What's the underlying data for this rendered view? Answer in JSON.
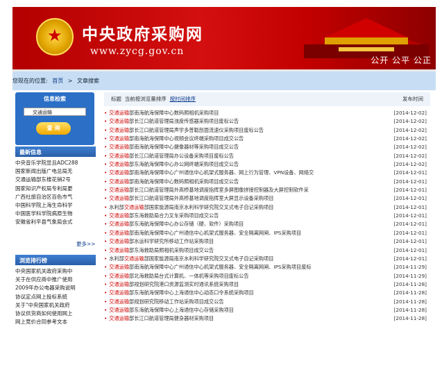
{
  "banner": {
    "title": "中央政府采购网",
    "url": "www.zycg.gov.cn",
    "slogan": "公开 公平 公正"
  },
  "breadcrumb": {
    "prefix": "您现在的位置:",
    "home": "首页",
    "sep": ">",
    "current": "文章搜索"
  },
  "search": {
    "title": "信息检索",
    "value": "交通运输",
    "button": "查 询"
  },
  "latest": {
    "title": "最新信息",
    "items": [
      "中央音乐学院显且ADC288",
      "国家新闻出版广电总局无",
      "交通运输部东楼花销2号",
      "国家知识产权局专利局更",
      "广西社旅自治区百色市气",
      "中国科学院上海生命科学",
      "中国医学科学院病原生物",
      "安徽省利辛县气象局会式"
    ],
    "more": "更多>>"
  },
  "ranking": {
    "title": "浏览排行榜",
    "items": [
      "中央国家机关政府采购中",
      "关于在供应商中推广使用",
      "2009年办公电器采购说明",
      "协议定点网上投标系统",
      "关于\"中央国家机关政府",
      "协议供货商如何使用网上",
      "网上竞价合同参考文本"
    ]
  },
  "list": {
    "header_title": "标题",
    "sort_current": "当前按浏览量排序",
    "sort_link": "按时间排序",
    "time_header": "发布时间",
    "rows": [
      {
        "pre": "",
        "hl": "交通运输",
        "rest": "部南海航海保障中心数码照相机采购项目",
        "date": "[2014-12-02]"
      },
      {
        "pre": "",
        "hl": "交通运输",
        "rest": "部长江口航道管理局浊度传感器采购项目废标公告",
        "date": "[2014-12-02]"
      },
      {
        "pre": "",
        "hl": "交通运输",
        "rest": "部长江口航道管理局声学多普勒剖面流速仪采购项目废标公告",
        "date": "[2014-12-02]"
      },
      {
        "pre": "",
        "hl": "交通运输",
        "rest": "部南海航海保障中心视频会议终端采购项目成交公告",
        "date": "[2014-12-02]"
      },
      {
        "pre": "",
        "hl": "交通运输",
        "rest": "部南海航海保障中心摄像器材等采购项目成交公告",
        "date": "[2014-12-02]"
      },
      {
        "pre": "",
        "hl": "交通运输",
        "rest": "部长江口航道管理局办公设备采购项目废标公告",
        "date": "[2014-12-02]"
      },
      {
        "pre": "",
        "hl": "交通运输",
        "rest": "部东海航海保障中心办公网终端采购项目成交公告",
        "date": "[2014-12-02]"
      },
      {
        "pre": "",
        "hl": "交通运输",
        "rest": "部南海航海保障中心广州通信中心机架式服务器、网上行为管理、VPN设备、网络交",
        "date": "[2014-12-01]"
      },
      {
        "pre": "",
        "hl": "交通运输",
        "rest": "部南海航海保障中心数码照相机采购项目成交公告",
        "date": "[2014-12-01]"
      },
      {
        "pre": "",
        "hl": "交通运输",
        "rest": "部长江口航道管理局外高桥基地调度指挥室多屏图像拼接控制器及大屏控制软件采",
        "date": "[2014-12-01]"
      },
      {
        "pre": "",
        "hl": "交通运输",
        "rest": "部长江口航道管理局外高桥基地调度指挥室大屏显示设备采购项目",
        "date": "[2014-12-01]"
      },
      {
        "pre": "水利部",
        "hl": "交通运输",
        "rest": "部国家能源局南京水利科学研究院交叉式电子自记采购项目",
        "date": "[2014-12-01]"
      },
      {
        "pre": "",
        "hl": "交通运输",
        "rest": "部东海救助局合力叉车采购项目成交公告",
        "date": "[2014-12-01]"
      },
      {
        "pre": "",
        "hl": "交通运输",
        "rest": "部东海航海保障中心办公存储（硬、软件）采购项目",
        "date": "[2014-12-01]"
      },
      {
        "pre": "",
        "hl": "交通运输",
        "rest": "部南海航海保障中心广州通信中心机架式服务器、安全隔离网闸、IPS采购项目",
        "date": "[2014-12-01]"
      },
      {
        "pre": "",
        "hl": "交通运输",
        "rest": "部水运科学研究所移动工作站采购项目",
        "date": "[2014-12-01]"
      },
      {
        "pre": "",
        "hl": "交通运输",
        "rest": "部东海救助局照相机采购项目成交公告",
        "date": "[2014-12-01]"
      },
      {
        "pre": "水利部",
        "hl": "交通运输",
        "rest": "部国家能源局南京水利科学研究院交叉式电子自记采购项目",
        "date": "[2014-12-01]"
      },
      {
        "pre": "",
        "hl": "交通运输",
        "rest": "部南海航海保障中心广州通信中心机架式服务器、安全隔离网闸、IPS采购项目废标",
        "date": "[2014-11-29]"
      },
      {
        "pre": "",
        "hl": "交通运输",
        "rest": "部北海救助局台式计算机、一体机等采购项目废标公告",
        "date": "[2014-11-29]"
      },
      {
        "pre": "",
        "hl": "交通运输",
        "rest": "部规划研究院港口资源监测实时通讯系统采购项目",
        "date": "[2014-11-28]"
      },
      {
        "pre": "",
        "hl": "交通运输",
        "rest": "部东海航海保障中心上海通信中心动态口令系统采购项目",
        "date": "[2014-11-28]"
      },
      {
        "pre": "",
        "hl": "交通运输",
        "rest": "部规划研究院移动工作站采购项目成交公告",
        "date": "[2014-11-28]"
      },
      {
        "pre": "",
        "hl": "交通运输",
        "rest": "部东海航海保障中心上海通信中心存储采购项目",
        "date": "[2014-11-28]"
      },
      {
        "pre": "",
        "hl": "交通运输",
        "rest": "部长江口航道管理局健身器材采购项目",
        "date": "[2014-11-28]"
      }
    ]
  },
  "colors": {
    "brand_red": "#c00000",
    "link_blue": "#0b3b8c",
    "sidebar_blue": "#2b6fc6"
  }
}
